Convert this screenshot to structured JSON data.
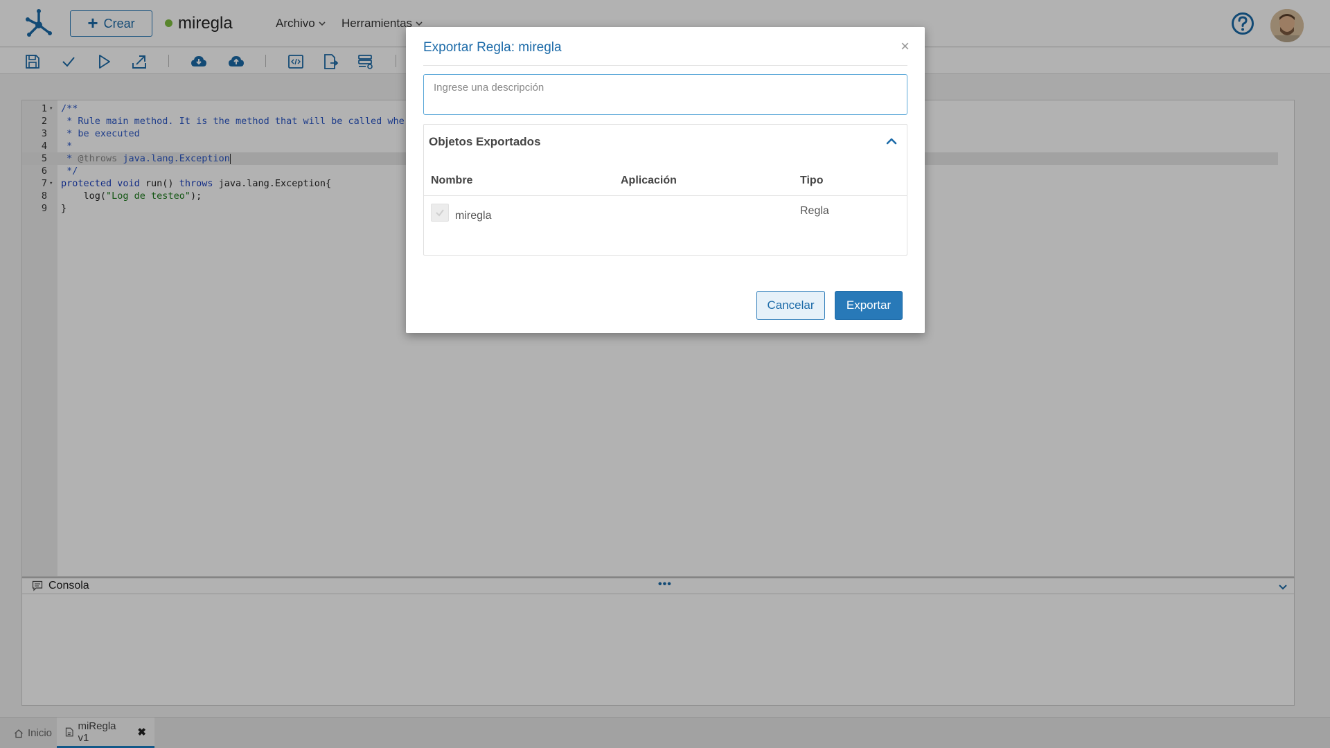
{
  "header": {
    "create_label": "Crear",
    "doc_title": "miregla",
    "status_color": "#7fbf3f",
    "menu_file": "Archivo",
    "menu_tools": "Herramientas"
  },
  "toolbar": {
    "icons": [
      "save-icon",
      "check-icon",
      "play-icon",
      "export-icon",
      "cloud-download-icon",
      "cloud-upload-icon",
      "code-icon",
      "document-arrow-icon",
      "list-settings-icon"
    ]
  },
  "editor": {
    "lines": [
      {
        "n": "1",
        "fold": true,
        "segments": [
          {
            "t": "/**",
            "k": "comment"
          }
        ]
      },
      {
        "n": "2",
        "fold": false,
        "segments": [
          {
            "t": " * Rule main method. It is the method that will be called whe",
            "k": "comment"
          }
        ]
      },
      {
        "n": "3",
        "fold": false,
        "segments": [
          {
            "t": " * be executed",
            "k": "comment"
          }
        ]
      },
      {
        "n": "4",
        "fold": false,
        "segments": [
          {
            "t": " *",
            "k": "comment"
          }
        ]
      },
      {
        "n": "5",
        "fold": false,
        "active": true,
        "segments": [
          {
            "t": " * ",
            "k": "comment"
          },
          {
            "t": "@throws",
            "k": "tag"
          },
          {
            "t": " java.lang.Exception",
            "k": "comment"
          }
        ]
      },
      {
        "n": "6",
        "fold": false,
        "segments": [
          {
            "t": " */",
            "k": "comment"
          }
        ]
      },
      {
        "n": "7",
        "fold": true,
        "segments": [
          {
            "t": "protected void",
            "k": "kw"
          },
          {
            "t": " run() ",
            "k": "plain"
          },
          {
            "t": "throws",
            "k": "kw"
          },
          {
            "t": " java.lang.Exception{",
            "k": "plain"
          }
        ]
      },
      {
        "n": "8",
        "fold": false,
        "segments": [
          {
            "t": "    log(",
            "k": "plain"
          },
          {
            "t": "\"Log de testeo\"",
            "k": "str"
          },
          {
            "t": ");",
            "k": "plain"
          }
        ]
      },
      {
        "n": "9",
        "fold": false,
        "segments": [
          {
            "t": "}",
            "k": "plain"
          }
        ]
      }
    ]
  },
  "console": {
    "label": "Consola",
    "dots": "•••"
  },
  "tabs": {
    "home_label": "Inicio",
    "rule_label": "miRegla v1",
    "close_glyph": "✖"
  },
  "modal": {
    "title": "Exportar Regla: miregla",
    "close_glyph": "×",
    "description_placeholder": "Ingrese una descripción",
    "description_value": "",
    "exported_title": "Objetos Exportados",
    "columns": {
      "name": "Nombre",
      "app": "Aplicación",
      "type": "Tipo"
    },
    "rows": [
      {
        "name": "miregla",
        "app": "",
        "type": "Regla",
        "checked": true
      }
    ],
    "cancel_label": "Cancelar",
    "export_label": "Exportar"
  },
  "colors": {
    "accent": "#1b6aa8",
    "primary_button": "#2879b8"
  }
}
